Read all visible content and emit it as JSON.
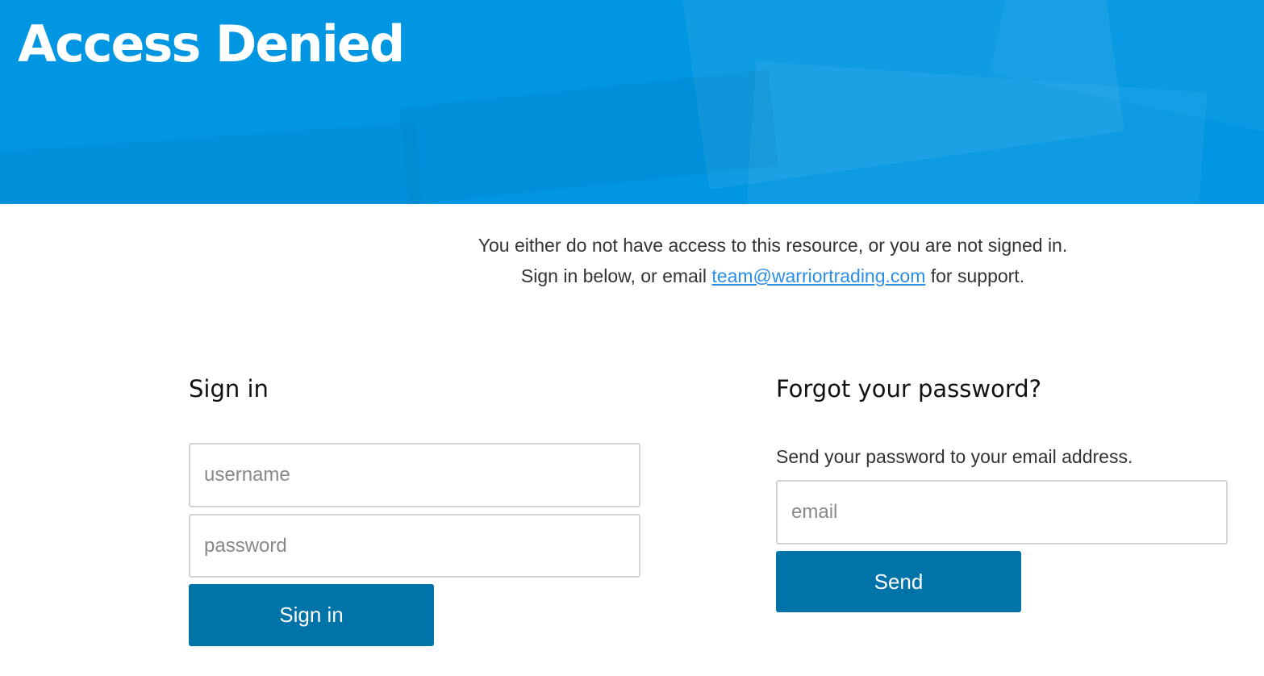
{
  "hero": {
    "title": "Access Denied"
  },
  "notice": {
    "line1": "You either do not have access to this resource, or you are not signed in.",
    "line2_prefix": "Sign in below, or email ",
    "support_email": "team@warriortrading.com",
    "line2_suffix": " for support."
  },
  "signin": {
    "heading": "Sign in",
    "username_placeholder": "username",
    "password_placeholder": "password",
    "button_label": "Sign in"
  },
  "forgot": {
    "heading": "Forgot your password?",
    "description": "Send your password to your email address.",
    "email_placeholder": "email",
    "button_label": "Send"
  },
  "colors": {
    "hero_background": "#0096e2",
    "button_background": "#0073a8",
    "link": "#2a8ee6"
  }
}
